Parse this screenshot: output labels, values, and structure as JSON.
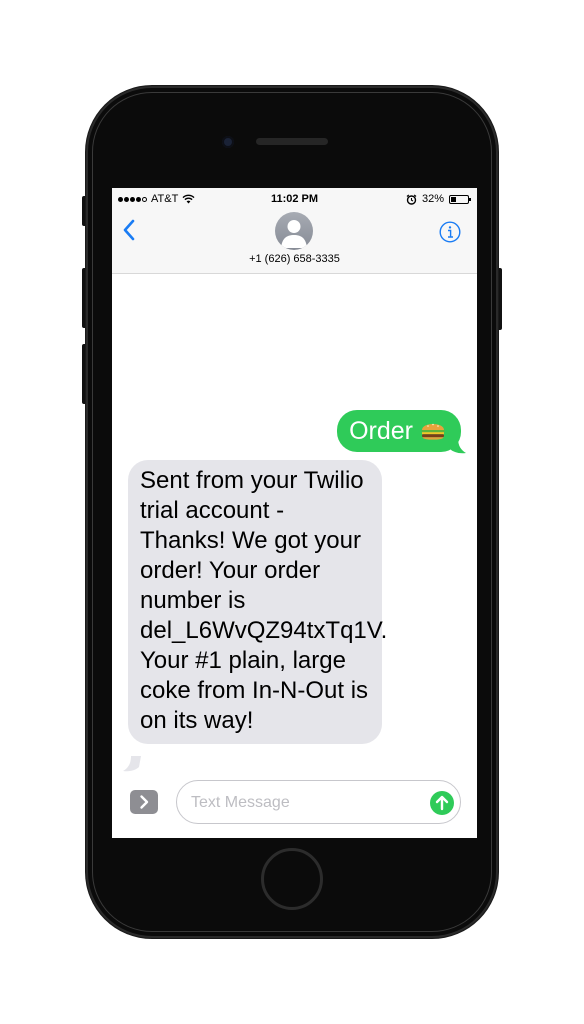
{
  "status_bar": {
    "carrier": "AT&T",
    "time": "11:02 PM",
    "battery_percent_label": "32%",
    "battery_level": 0.32,
    "signal_bars": 4,
    "signal_total": 5
  },
  "nav": {
    "contact_number": "+1 (626) 658-3335",
    "back_icon": "chevron-left-icon",
    "info_icon": "info-icon"
  },
  "messages": {
    "sent": {
      "text": "Order",
      "emoji_icon": "hamburger-icon"
    },
    "received": {
      "text": "Sent from your Twilio trial account - Thanks! We got your order! Your order number is del_L6WvQZ94txTq1V. Your #1 plain, large coke from In-N-Out is on its way!"
    }
  },
  "compose": {
    "placeholder": "Text Message",
    "value": "",
    "expand_icon": "chevron-right-icon",
    "send_icon": "arrow-up-icon"
  },
  "colors": {
    "sent_bubble": "#2fcb59",
    "received_bubble": "#e5e5ea",
    "accent": "#1a7cf4",
    "send_button": "#2fcb59"
  }
}
